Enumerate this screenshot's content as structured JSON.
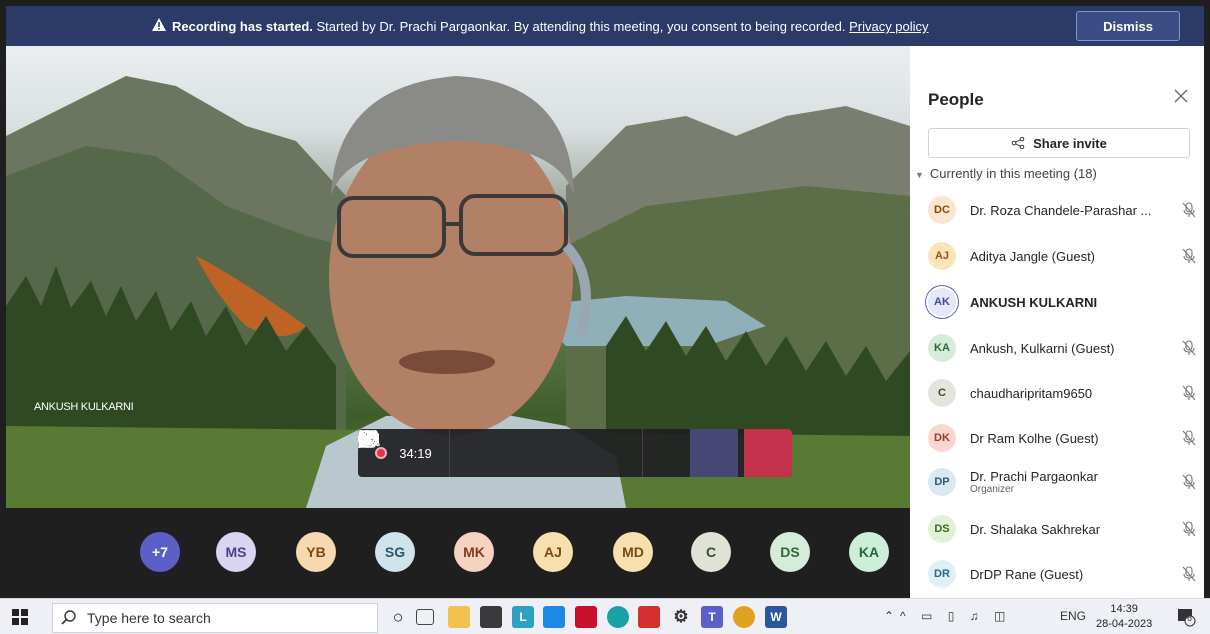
{
  "banner": {
    "bold_text": "Recording has started.",
    "message": " Started by Dr. Prachi Pargaonkar. By attending this meeting, you consent to being recorded. ",
    "link": "Privacy policy",
    "dismiss_label": "Dismiss"
  },
  "stage": {
    "self_name": "ANKUSH KULKARNI"
  },
  "call_bar": {
    "timer": "34:19"
  },
  "gallery": {
    "avatars": [
      {
        "initials": "+7",
        "bg": "#5b5fc7",
        "fg": "#ffffff"
      },
      {
        "initials": "MS",
        "bg": "#d9d4ef",
        "fg": "#4a3f8a"
      },
      {
        "initials": "YB",
        "bg": "#f7d9b0",
        "fg": "#7a4a12"
      },
      {
        "initials": "SG",
        "bg": "#cfe3ea",
        "fg": "#255a6e"
      },
      {
        "initials": "MK",
        "bg": "#f6d3c1",
        "fg": "#8a3a1a"
      },
      {
        "initials": "AJ",
        "bg": "#f9dfae",
        "fg": "#7a4a12"
      },
      {
        "initials": "MD",
        "bg": "#f9dfae",
        "fg": "#7a4a12"
      },
      {
        "initials": "C",
        "bg": "#dfe3d6",
        "fg": "#3e4a2a"
      },
      {
        "initials": "DS",
        "bg": "#d4ecd9",
        "fg": "#2a6a3a"
      },
      {
        "initials": "KA",
        "bg": "#cdeed8",
        "fg": "#1f6a3a"
      }
    ]
  },
  "panel": {
    "title": "People",
    "share_label": "Share invite",
    "section": "Currently in this meeting (18)",
    "people": [
      {
        "initials": "DC",
        "name": "Dr. Roza Chandele-Parashar ...",
        "sub": "",
        "bg": "#fbe5cf",
        "fg": "#8a4a12",
        "muted": true,
        "bold": false
      },
      {
        "initials": "AJ",
        "name": "Aditya Jangle (Guest)",
        "sub": "",
        "bg": "#fbe5b8",
        "fg": "#8a5a12",
        "muted": true,
        "bold": false
      },
      {
        "initials": "AK",
        "name": "ANKUSH KULKARNI",
        "sub": "",
        "bg": "#e6e8f7",
        "fg": "#3e4a8a",
        "muted": false,
        "bold": true
      },
      {
        "initials": "KA",
        "name": "Ankush, Kulkarni (Guest)",
        "sub": "",
        "bg": "#d4ecd9",
        "fg": "#2a6a3a",
        "muted": true,
        "bold": false
      },
      {
        "initials": "C",
        "name": "chaudharipritam9650",
        "sub": "",
        "bg": "#e3e5dc",
        "fg": "#3e4a2a",
        "muted": true,
        "bold": false
      },
      {
        "initials": "DK",
        "name": "Dr Ram Kolhe (Guest)",
        "sub": "",
        "bg": "#f9d6d0",
        "fg": "#a03a2a",
        "muted": true,
        "bold": false
      },
      {
        "initials": "DP",
        "name": "Dr. Prachi Pargaonkar",
        "sub": "Organizer",
        "bg": "#dbe8ef",
        "fg": "#2a5a7a",
        "muted": true,
        "bold": false
      },
      {
        "initials": "DS",
        "name": "Dr. Shalaka Sakhrekar",
        "sub": "",
        "bg": "#e2f0d6",
        "fg": "#3a6a22",
        "muted": true,
        "bold": false
      },
      {
        "initials": "DR",
        "name": "DrDP Rane (Guest)",
        "sub": "",
        "bg": "#dff0f6",
        "fg": "#2a6a8a",
        "muted": true,
        "bold": false
      }
    ]
  },
  "taskbar": {
    "search_placeholder": "Type here to search",
    "lang": "ENG",
    "time": "14:39",
    "date": "28-04-2023",
    "notif_count": "6"
  }
}
